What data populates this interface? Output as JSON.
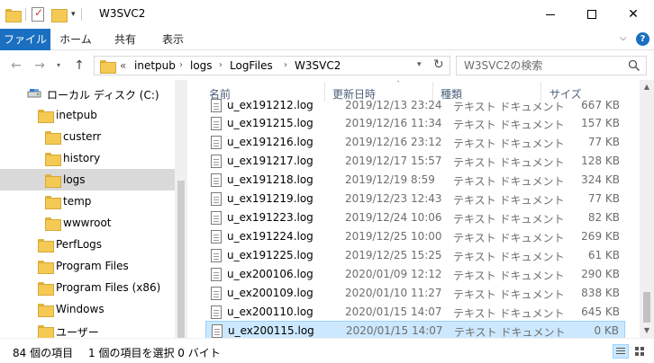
{
  "window": {
    "title": "W3SVC2"
  },
  "ribbon": {
    "tabs": [
      {
        "label": "ファイル"
      },
      {
        "label": "ホーム"
      },
      {
        "label": "共有"
      },
      {
        "label": "表示"
      }
    ]
  },
  "address": {
    "crumbs": [
      "«",
      "inetpub",
      "logs",
      "LogFiles",
      "W3SVC2"
    ]
  },
  "search": {
    "placeholder": "W3SVC2の検索"
  },
  "navpane": {
    "items": [
      {
        "label": "ローカル ディスク (C:)"
      },
      {
        "label": "inetpub"
      },
      {
        "label": "custerr"
      },
      {
        "label": "history"
      },
      {
        "label": "logs"
      },
      {
        "label": "temp"
      },
      {
        "label": "wwwroot"
      },
      {
        "label": "PerfLogs"
      },
      {
        "label": "Program Files"
      },
      {
        "label": "Program Files (x86)"
      },
      {
        "label": "Windows"
      },
      {
        "label": "ユーザー"
      }
    ]
  },
  "filelist": {
    "columns": {
      "name": "名前",
      "date": "更新日時",
      "type": "種類",
      "size": "サイズ"
    },
    "rows": [
      {
        "name": "u_ex191212.log",
        "date": "2019/12/13 23:24",
        "type": "テキスト ドキュメント",
        "size": "667 KB"
      },
      {
        "name": "u_ex191215.log",
        "date": "2019/12/16 11:34",
        "type": "テキスト ドキュメント",
        "size": "157 KB"
      },
      {
        "name": "u_ex191216.log",
        "date": "2019/12/16 23:12",
        "type": "テキスト ドキュメント",
        "size": "77 KB"
      },
      {
        "name": "u_ex191217.log",
        "date": "2019/12/17 15:57",
        "type": "テキスト ドキュメント",
        "size": "128 KB"
      },
      {
        "name": "u_ex191218.log",
        "date": "2019/12/19 8:59",
        "type": "テキスト ドキュメント",
        "size": "324 KB"
      },
      {
        "name": "u_ex191219.log",
        "date": "2019/12/23 12:43",
        "type": "テキスト ドキュメント",
        "size": "77 KB"
      },
      {
        "name": "u_ex191223.log",
        "date": "2019/12/24 10:06",
        "type": "テキスト ドキュメント",
        "size": "82 KB"
      },
      {
        "name": "u_ex191224.log",
        "date": "2019/12/25 10:00",
        "type": "テキスト ドキュメント",
        "size": "269 KB"
      },
      {
        "name": "u_ex191225.log",
        "date": "2019/12/25 15:25",
        "type": "テキスト ドキュメント",
        "size": "61 KB"
      },
      {
        "name": "u_ex200106.log",
        "date": "2020/01/09 12:12",
        "type": "テキスト ドキュメント",
        "size": "290 KB"
      },
      {
        "name": "u_ex200109.log",
        "date": "2020/01/10 11:27",
        "type": "テキスト ドキュメント",
        "size": "838 KB"
      },
      {
        "name": "u_ex200110.log",
        "date": "2020/01/15 14:07",
        "type": "テキスト ドキュメント",
        "size": "645 KB"
      },
      {
        "name": "u_ex200115.log",
        "date": "2020/01/15 14:07",
        "type": "テキスト ドキュメント",
        "size": "0 KB"
      }
    ]
  },
  "status": {
    "item_count": "84 個の項目",
    "selection": "1 個の項目を選択  0 バイト"
  },
  "colors": {
    "accent": "#1a6fc1",
    "selection": "#cce8ff",
    "folder": "#f4ca54"
  }
}
